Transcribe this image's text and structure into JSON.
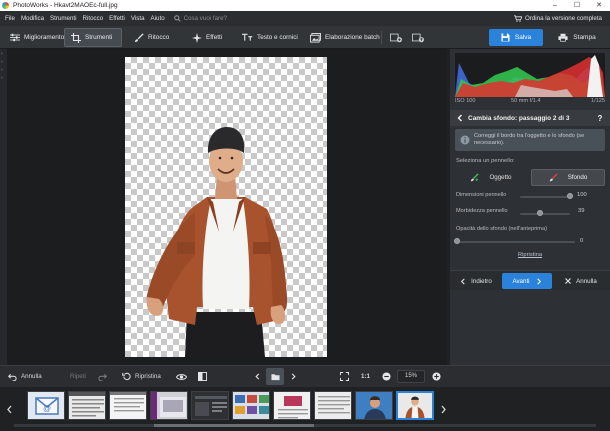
{
  "window": {
    "title": "PhotoWorks - Hkavt2MAOEc-full.jpg"
  },
  "menu": {
    "items": [
      "File",
      "Modifica",
      "Strumenti",
      "Ritocco",
      "Effetti",
      "Vista",
      "Aiuto"
    ],
    "search_placeholder": "Cosa vuoi fare?",
    "buy_label": "Ordina la versione completa"
  },
  "toolbar": {
    "tabs": [
      "Miglioramento",
      "Strumenti",
      "Ritocco",
      "Effetti",
      "Testo e cornici",
      "Elaborazione batch"
    ],
    "active_tab": "Strumenti",
    "save_label": "Salva",
    "print_label": "Stampa"
  },
  "exif": {
    "iso": "ISO 100",
    "focal": "50 mm f/1.4",
    "shutter": "1/125"
  },
  "panel": {
    "title": "Cambia sfondo: passaggio 2 di 3",
    "hint": "Correggi il bordo tra l'oggetto e lo sfondo (se necessario).",
    "brush_label": "Seleziona un pennello:",
    "object_label": "Oggetto",
    "background_label": "Sfondo",
    "selected_brush": "Sfondo",
    "sliders": [
      {
        "label": "Dimensioni pennello",
        "value": "100",
        "fraction": 1.0
      },
      {
        "label": "Morbidezza pennello",
        "value": "39",
        "fraction": 0.39
      },
      {
        "label": "Opacità dello sfondo (nell'anteprima)",
        "value": "0",
        "fraction": 0.0
      }
    ],
    "reset_label": "Ripristina",
    "back_label": "Indietro",
    "next_label": "Avanti",
    "cancel_label": "Annulla"
  },
  "bottom": {
    "undo_label": "Annulla",
    "redo_label": "Ripeti",
    "restore_label": "Ripristina",
    "fit_label": "1:1",
    "zoom": "15%"
  },
  "colors": {
    "accent": "#2a82da",
    "panel_bg": "#2d3034",
    "canvas_bg": "#1c1d1f",
    "checker": "#c9c9c9",
    "shirt": "#a8532e"
  },
  "filmstrip": {
    "thumbs": [
      "email",
      "document",
      "document",
      "gallery",
      "dark-window",
      "slides",
      "document",
      "document",
      "portrait-blue",
      "portrait-orange"
    ],
    "active_index": 9
  }
}
